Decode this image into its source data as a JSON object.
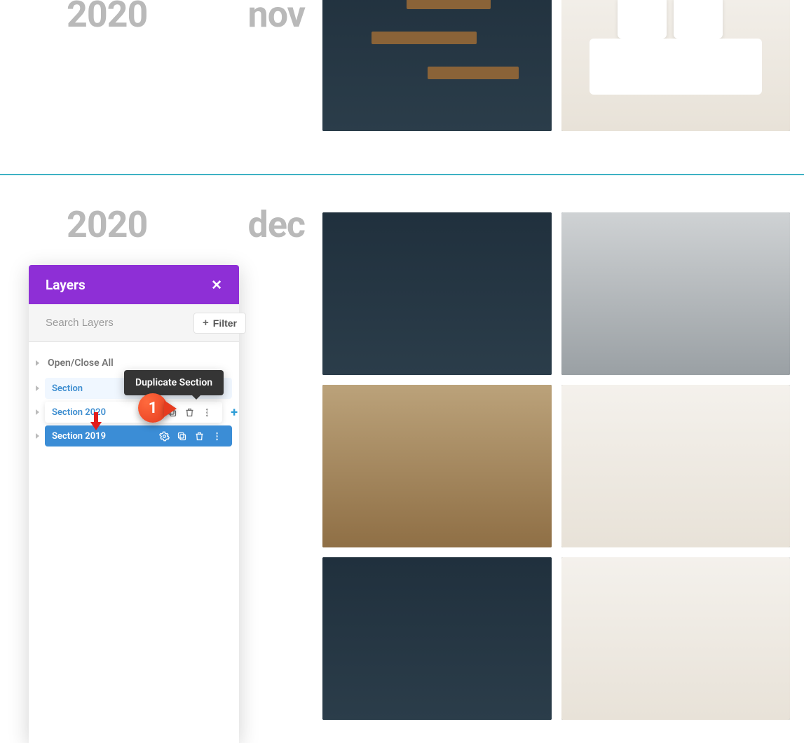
{
  "sections": [
    {
      "year": "2020",
      "month": "nov"
    },
    {
      "year": "2020",
      "month": "dec"
    }
  ],
  "panel": {
    "title": "Layers",
    "close_glyph": "✕",
    "search_placeholder": "Search Layers",
    "filter_plus": "+",
    "filter_label": "Filter",
    "open_close": "Open/Close All",
    "items": [
      {
        "label": "Section"
      },
      {
        "label": "Section 2020"
      },
      {
        "label": "Section 2019"
      }
    ],
    "tooltip": "Duplicate Section",
    "add_plus": "+",
    "callout_number": "1"
  }
}
